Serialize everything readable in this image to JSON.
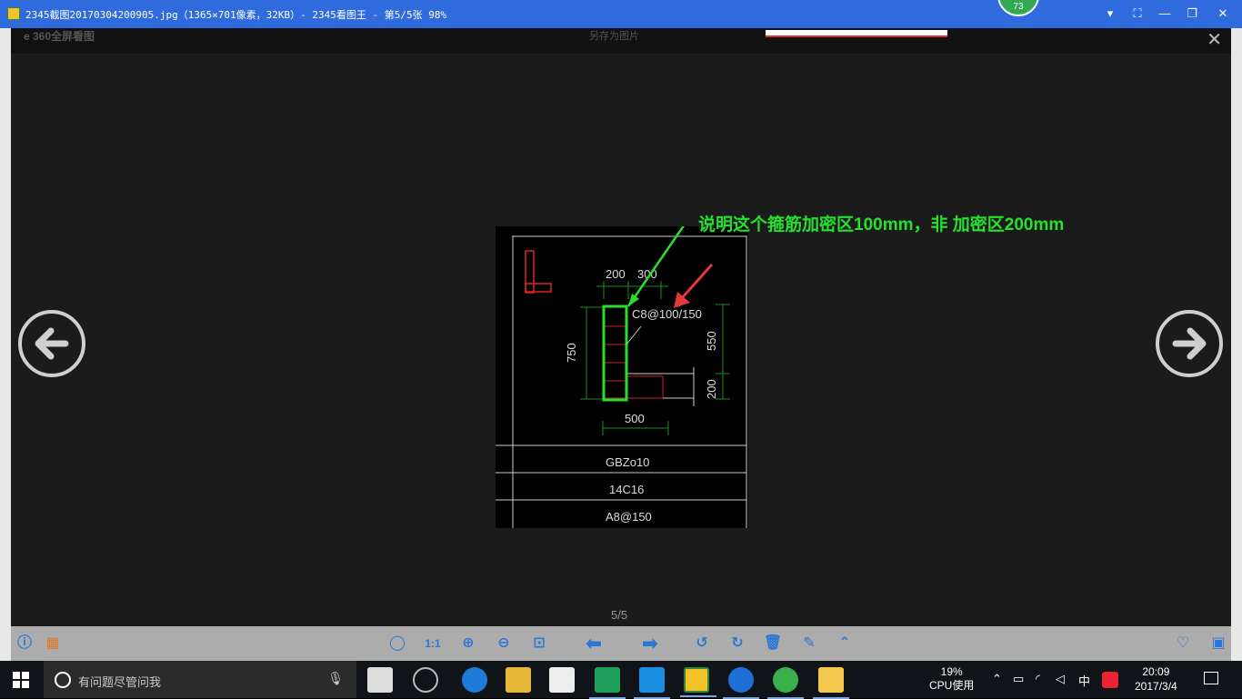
{
  "window": {
    "title": "2345截图20170304200905.jpg（1365×701像素，32KB）- 2345看图王 - 第5/5张 98%",
    "badge": "73",
    "controls": [
      "▾",
      "⛶",
      "—",
      "❐",
      "✕"
    ]
  },
  "viewer": {
    "logo": "e 360全屏看图",
    "save_label": "另存为图片",
    "close": "✕",
    "counter": "5/5",
    "annotation": "说明这个箍筋加密区100mm，非 加密区200mm"
  },
  "drawing": {
    "dim_top_left": "200",
    "dim_top_right": "300",
    "stirrup_label": "C8@100/150",
    "dim_left": "750",
    "dim_right": "550",
    "dim_right_lower": "200",
    "dim_bottom": "500",
    "table_rows": [
      "GBZo10",
      "14C16",
      "A8@150"
    ]
  },
  "toolbar": {
    "left": [
      {
        "name": "info-icon",
        "glyph": "ⓘ"
      },
      {
        "name": "gift-icon",
        "glyph": "▦"
      }
    ],
    "center": [
      {
        "name": "mouse-icon",
        "glyph": "◯"
      },
      {
        "name": "actual-size-icon",
        "glyph": "1:1"
      },
      {
        "name": "zoom-in-icon",
        "glyph": "⊕"
      },
      {
        "name": "zoom-out-icon",
        "glyph": "⊖"
      },
      {
        "name": "fit-window-icon",
        "glyph": "⊡"
      },
      {
        "name": "prev-arrow-icon",
        "glyph": "⬅"
      },
      {
        "name": "next-arrow-icon",
        "glyph": "➡"
      },
      {
        "name": "rotate-left-icon",
        "glyph": "↺"
      },
      {
        "name": "rotate-right-icon",
        "glyph": "↻"
      },
      {
        "name": "delete-icon",
        "glyph": "🗑"
      },
      {
        "name": "edit-icon",
        "glyph": "✎"
      },
      {
        "name": "more-icon",
        "glyph": "⌃"
      }
    ],
    "right": [
      {
        "name": "favorite-icon",
        "glyph": "♡"
      },
      {
        "name": "folder-search-icon",
        "glyph": "▣"
      }
    ]
  },
  "taskbar": {
    "search_placeholder": "有问题尽管问我",
    "cpu_percent": "19%",
    "cpu_label": "CPU使用",
    "ime": "中",
    "time": "20:09",
    "date": "2017/3/4"
  },
  "colors": {
    "titlebar": "#2f6bdc",
    "annotation": "#27e02d",
    "toolbar_icon": "#2a78d4"
  }
}
